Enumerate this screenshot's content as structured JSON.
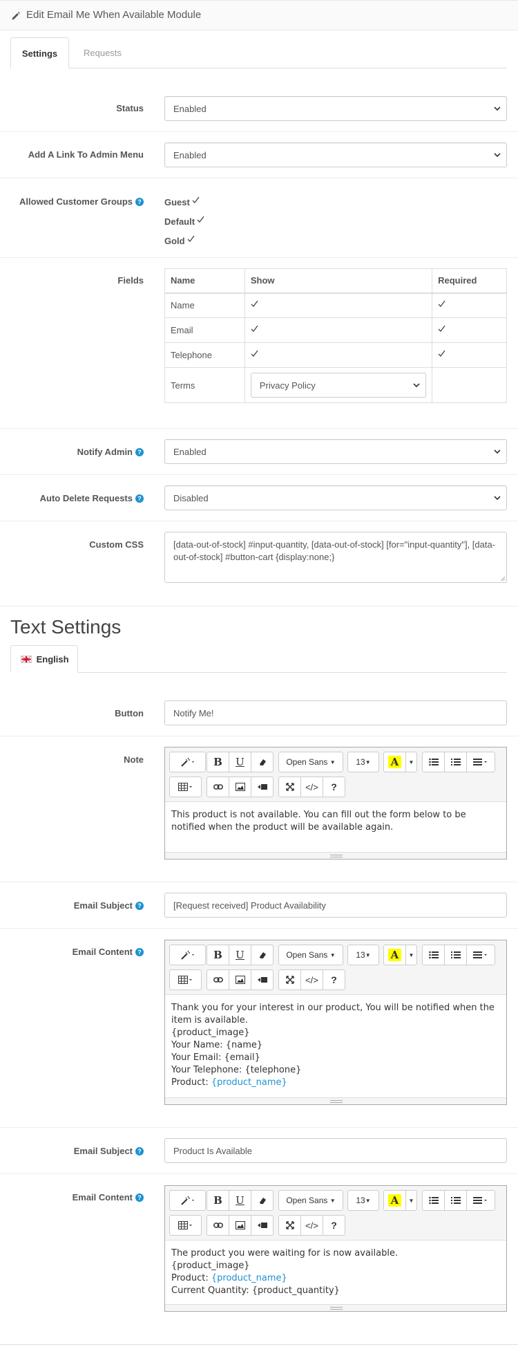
{
  "header": {
    "title": "Edit Email Me When Available Module"
  },
  "tabs": [
    {
      "label": "Settings",
      "active": true
    },
    {
      "label": "Requests",
      "active": false
    }
  ],
  "status": {
    "label": "Status",
    "value": "Enabled"
  },
  "admin_menu": {
    "label": "Add A Link To Admin Menu",
    "value": "Enabled"
  },
  "customer_groups": {
    "label": "Allowed Customer Groups",
    "items": [
      "Guest",
      "Default",
      "Gold"
    ]
  },
  "fields": {
    "label": "Fields",
    "headers": [
      "Name",
      "Show",
      "Required"
    ],
    "rows": [
      {
        "name": "Name",
        "show": true,
        "required": true
      },
      {
        "name": "Email",
        "show": true,
        "required": true
      },
      {
        "name": "Telephone",
        "show": true,
        "required": true
      }
    ],
    "terms": {
      "name": "Terms",
      "value": "Privacy Policy"
    }
  },
  "notify_admin": {
    "label": "Notify Admin",
    "value": "Enabled"
  },
  "auto_delete": {
    "label": "Auto Delete Requests",
    "value": "Disabled"
  },
  "custom_css": {
    "label": "Custom CSS",
    "value": "[data-out-of-stock] #input-quantity, [data-out-of-stock] [for=\"input-quantity\"], [data-out-of-stock] #button-cart {display:none;}"
  },
  "text_settings": {
    "title": "Text Settings",
    "language_tab": "English",
    "button": {
      "label": "Button",
      "value": "Notify Me!"
    },
    "note": {
      "label": "Note",
      "content": "This product is not available. You can fill out the form below to be notified when the product will be available again."
    },
    "email_subject_1": {
      "label": "Email Subject",
      "value": "[Request received] Product Availability"
    },
    "email_content_1": {
      "label": "Email Content",
      "line1": "Thank you for your interest in our product, You will be notified when the item is available.",
      "line2": "{product_image}",
      "line3": "Your Name: {name}",
      "line4": "Your Email: {email}",
      "line5": "Your Telephone: {telephone}",
      "line6_prefix": "Product: ",
      "line6_link": "{product_name}"
    },
    "email_subject_2": {
      "label": "Email Subject",
      "value": "Product Is Available"
    },
    "email_content_2": {
      "label": "Email Content",
      "line1": "The product you were waiting for is now available.",
      "line2": "{product_image}",
      "line3_prefix": "Product: ",
      "line3_link": "{product_name}",
      "line4": "Current Quantity: {product_quantity}"
    }
  },
  "editor_toolbar": {
    "font_name": "Open Sans",
    "font_size": "13",
    "help": "?",
    "code": "</>",
    "bold": "B",
    "underline": "U",
    "color": "A"
  },
  "help_icon_glyph": "?",
  "colors": {
    "link": "#1e91cf",
    "help": "#1e91cf",
    "highlight": "#ffff00"
  }
}
